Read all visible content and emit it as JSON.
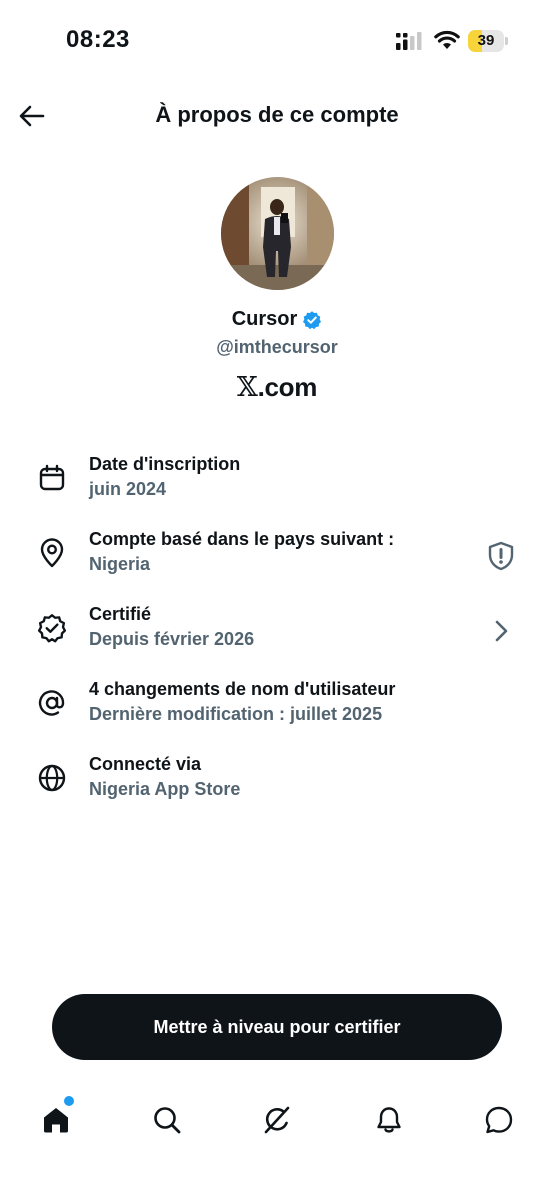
{
  "status_bar": {
    "time": "08:23",
    "battery_level": "39",
    "battery_fraction": 0.39,
    "battery_color": "#f7d43a"
  },
  "header": {
    "title": "À propos de ce compte",
    "back_icon": "arrow-left-icon"
  },
  "profile": {
    "display_name": "Cursor",
    "verified_icon": "verified-badge-icon",
    "verified_color": "#1d9bf0",
    "handle": "@imthecursor",
    "site_logo": "𝕏",
    "site_suffix": ".com"
  },
  "info_items": [
    {
      "icon": "calendar-icon",
      "title": "Date d'inscription",
      "subtitle": "juin 2024"
    },
    {
      "icon": "location-pin-icon",
      "title": "Compte basé dans le pays suivant :",
      "subtitle": "Nigeria",
      "right_icon": "shield-alert-icon"
    },
    {
      "icon": "verified-outline-icon",
      "title": "Certifié",
      "subtitle": "Depuis février 2026",
      "right_icon": "chevron-right-icon"
    },
    {
      "icon": "at-sign-icon",
      "title": "4 changements de nom d'utilisateur",
      "subtitle": "Dernière modification : juillet 2025"
    },
    {
      "icon": "globe-icon",
      "title": "Connecté via",
      "subtitle": "Nigeria App Store"
    }
  ],
  "cta": {
    "label": "Mettre à niveau pour certifier"
  },
  "tabbar": {
    "tabs": [
      {
        "icon": "home-icon",
        "active": true,
        "has_notification_dot": true
      },
      {
        "icon": "search-icon"
      },
      {
        "icon": "grok-icon"
      },
      {
        "icon": "bell-icon"
      },
      {
        "icon": "messages-icon"
      }
    ],
    "accent": "#1d9bf0"
  }
}
